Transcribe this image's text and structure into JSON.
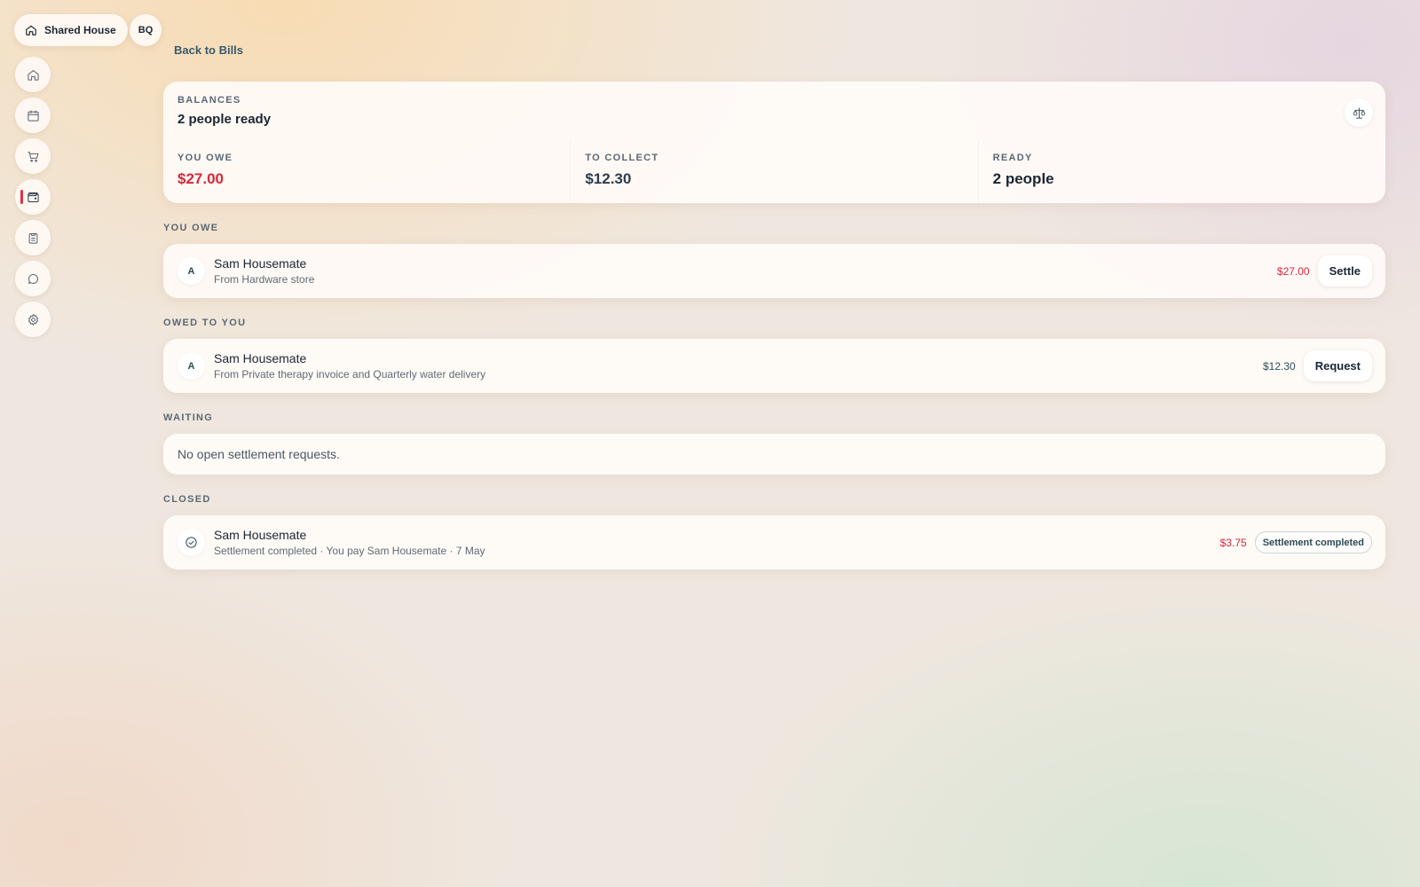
{
  "header": {
    "house_name": "Shared House",
    "user_initials": "BQ",
    "back_label": "Back to Bills"
  },
  "nav": {
    "items": [
      {
        "icon": "home-icon"
      },
      {
        "icon": "calendar-icon"
      },
      {
        "icon": "cart-icon"
      },
      {
        "icon": "wallet-icon",
        "active": true
      },
      {
        "icon": "clipboard-icon"
      },
      {
        "icon": "chat-icon"
      },
      {
        "icon": "gear-icon"
      }
    ]
  },
  "balances": {
    "eyebrow": "BALANCES",
    "subtitle": "2 people ready",
    "you_owe_label": "YOU OWE",
    "you_owe_value": "$27.00",
    "to_collect_label": "TO COLLECT",
    "to_collect_value": "$12.30",
    "ready_label": "READY",
    "ready_value": "2 people"
  },
  "sections": {
    "you_owe": {
      "label": "YOU OWE",
      "rows": [
        {
          "avatar": "A",
          "name": "Sam Housemate",
          "desc": "From Hardware store",
          "amount": "$27.00",
          "action": "Settle"
        }
      ]
    },
    "owed_to_you": {
      "label": "OWED TO YOU",
      "rows": [
        {
          "avatar": "A",
          "name": "Sam Housemate",
          "desc": "From Private therapy invoice and Quarterly water delivery",
          "amount": "$12.30",
          "action": "Request"
        }
      ]
    },
    "waiting": {
      "label": "WAITING",
      "empty": "No open settlement requests."
    },
    "closed": {
      "label": "CLOSED",
      "rows": [
        {
          "name": "Sam Housemate",
          "desc": "Settlement completed · You pay Sam Housemate · 7 May",
          "amount": "$3.75",
          "status": "Settlement completed"
        }
      ]
    }
  },
  "colors": {
    "accent_red": "#d7283e",
    "teal": "#2d4f58"
  }
}
